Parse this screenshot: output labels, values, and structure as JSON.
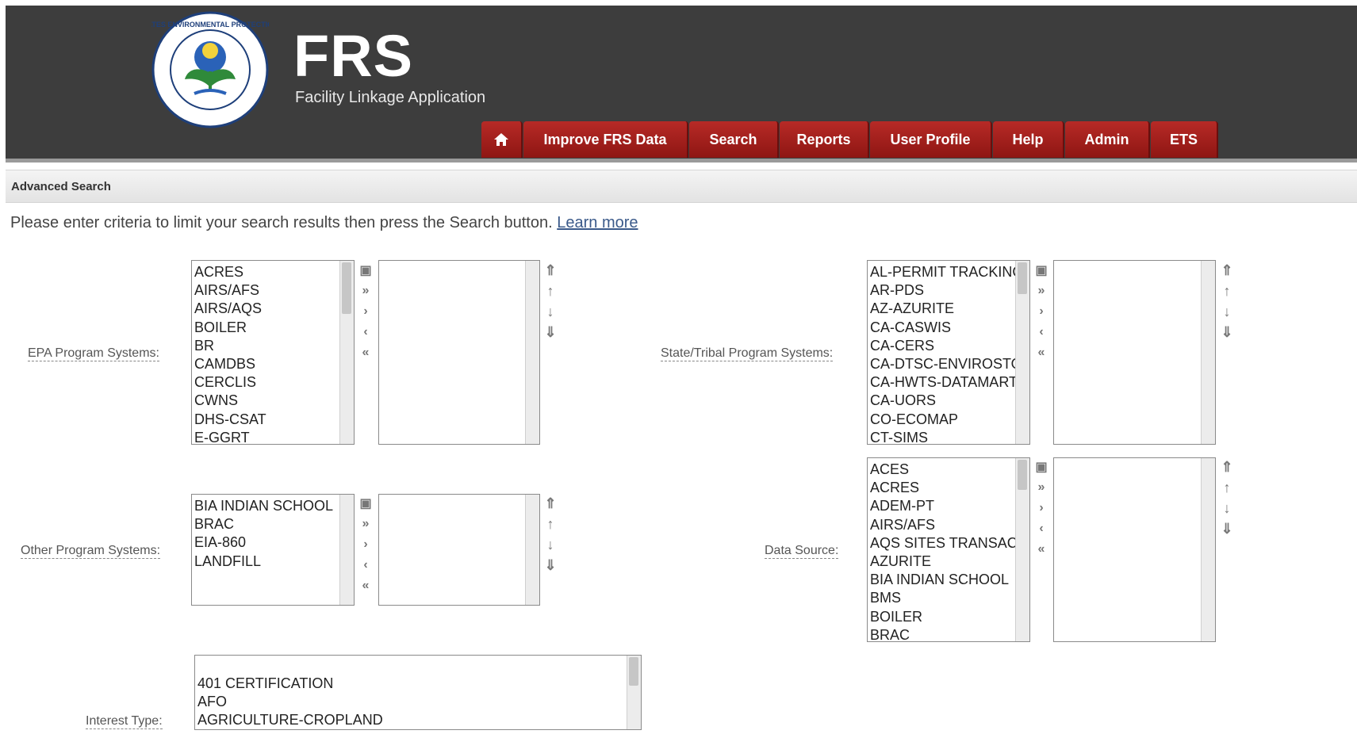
{
  "header": {
    "seal_text": "UNITED STATES ENVIRONMENTAL PROTECTION AGENCY",
    "app_title": "FRS",
    "app_subtitle": "Facility Linkage Application",
    "nav": [
      {
        "label": "",
        "icon": "home-icon"
      },
      {
        "label": "Improve FRS Data"
      },
      {
        "label": "Search"
      },
      {
        "label": "Reports"
      },
      {
        "label": "User Profile"
      },
      {
        "label": "Help"
      },
      {
        "label": "Admin"
      },
      {
        "label": "ETS"
      }
    ]
  },
  "page": {
    "title": "Advanced Search",
    "intro": "Please enter criteria to limit your search results then press the Search button.",
    "learn_more": "Learn more"
  },
  "fields": {
    "epa": {
      "label": "EPA Program Systems:",
      "options": [
        "ACRES",
        "AIRS/AFS",
        "AIRS/AQS",
        "BOILER",
        "BR",
        "CAMDBS",
        "CERCLIS",
        "CWNS",
        "DHS-CSAT",
        "E-GGRT"
      ]
    },
    "state": {
      "label": "State/Tribal Program Systems:",
      "options": [
        "AL-PERMIT TRACKING",
        "AR-PDS",
        "AZ-AZURITE",
        "CA-CASWIS",
        "CA-CERS",
        "CA-DTSC-ENVIROSTOR",
        "CA-HWTS-DATAMART",
        "CA-UORS",
        "CO-ECOMAP",
        "CT-SIMS"
      ]
    },
    "other": {
      "label": "Other Program Systems:",
      "options": [
        "BIA INDIAN SCHOOL",
        "BRAC",
        "EIA-860",
        "LANDFILL"
      ]
    },
    "datasource": {
      "label": "Data Source:",
      "options": [
        "ACES",
        "ACRES",
        "ADEM-PT",
        "AIRS/AFS",
        "AQS SITES TRANSACTIONS",
        "AZURITE",
        "BIA INDIAN SCHOOL",
        "BMS",
        "BOILER",
        "BRAC"
      ]
    },
    "interest": {
      "label": "Interest Type:",
      "options": [
        "401 CERTIFICATION",
        "AFO",
        "AGRICULTURE-CROPLAND"
      ]
    }
  },
  "buttons": {
    "select_all": "▣",
    "add_all": "»",
    "add": "›",
    "remove": "‹",
    "remove_all": "«",
    "move_top": "⇑",
    "move_up": "↑",
    "move_down": "↓",
    "move_bottom": "⇓"
  },
  "colors": {
    "header_bg": "#3d3d3d",
    "nav_red": "#a5201d",
    "link": "#3b5a8a"
  }
}
